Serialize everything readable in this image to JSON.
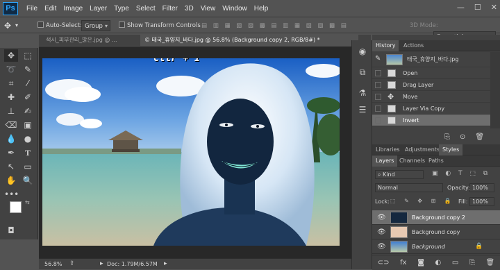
{
  "app": {
    "logo": "Ps",
    "menus": [
      "File",
      "Edit",
      "Image",
      "Layer",
      "Type",
      "Select",
      "Filter",
      "3D",
      "View",
      "Window",
      "Help"
    ],
    "window_controls": [
      "—",
      "☐",
      "✕"
    ]
  },
  "options_bar": {
    "auto_select_label": "Auto-Select:",
    "auto_select_value": "Group",
    "show_transform_label": "Show Transform Controls",
    "mode_3d_label": "3D Mode:",
    "workspace_value": "Essentials"
  },
  "tabs": [
    {
      "label": "색시_피부관리_밝은.jpg @ ...",
      "active": false
    },
    {
      "label": "© 태국_휴양지_바다.jpg @ 56.8% (Background copy 2, RGB/8#) *",
      "active": true
    }
  ],
  "canvas": {
    "overlay_text": "Ctlr + I"
  },
  "status": {
    "zoom": "56.8%",
    "doc_info": "Doc: 1.79M/6.57M"
  },
  "history_panel": {
    "tabs": [
      "History",
      "Actions"
    ],
    "source_label": "태국_휴양지_바다.jpg",
    "items": [
      "Open",
      "Drag Layer",
      "Move",
      "Layer Via Copy",
      "Invert"
    ]
  },
  "library_tabs": [
    "Libraries",
    "Adjustments",
    "Styles"
  ],
  "layers_panel": {
    "tabs": [
      "Layers",
      "Channels",
      "Paths"
    ],
    "filter_kind": "Kind",
    "blend_mode": "Normal",
    "opacity_label": "Opacity:",
    "opacity_value": "100%",
    "lock_label": "Lock:",
    "fill_label": "Fill:",
    "fill_value": "100%",
    "layers": [
      {
        "name": "Background copy 2",
        "selected": true
      },
      {
        "name": "Background copy",
        "selected": false
      },
      {
        "name": "Background",
        "selected": false,
        "locked": true
      }
    ]
  },
  "colors": {
    "ps_blue": "#31a8ff",
    "panel_bg": "#424242",
    "chrome_bg": "#535353",
    "selected_row": "#6e6e6e"
  }
}
